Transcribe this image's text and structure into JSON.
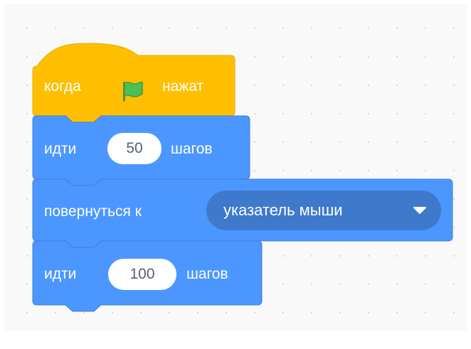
{
  "script": {
    "hat_block": {
      "label_before": "когда",
      "label_after": "нажат",
      "icon": "green-flag-icon"
    },
    "move_block_1": {
      "label": "идти",
      "value": "50",
      "unit": "шагов"
    },
    "point_towards_block": {
      "label": "повернуться к",
      "selected_option": "указатель мыши",
      "icon": "dropdown-arrow-icon"
    },
    "move_block_2": {
      "label": "идти",
      "value": "100",
      "unit": "шагов"
    }
  },
  "colors": {
    "events": "#ffbf00",
    "events_border": "#e6ac00",
    "motion": "#4c97ff",
    "motion_border": "#3d7fd6",
    "motion_dropdown": "#3e79cc",
    "flag_green": "#4cbf56"
  }
}
